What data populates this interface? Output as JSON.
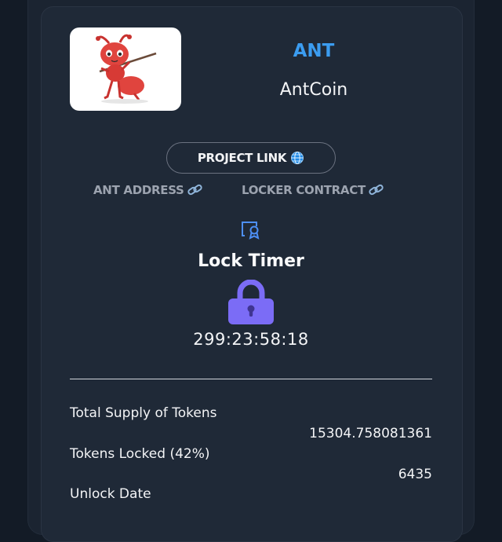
{
  "token": {
    "symbol": "ANT",
    "name": "AntCoin",
    "logo_icon": "ant-mascot-logo"
  },
  "links": {
    "project_label": "PROJECT LINK",
    "project_icon": "globe-icon",
    "address_label": "ANT ADDRESS",
    "contract_label": "LOCKER CONTRACT",
    "link_icon": "chain-link-icon"
  },
  "lock": {
    "badge_icon": "certificate-icon",
    "title": "Lock Timer",
    "lock_icon": "padlock-icon",
    "countdown": "299:23:58:18"
  },
  "stats": {
    "total_supply_label": "Total Supply of Tokens",
    "total_supply_value": "15304.758081361",
    "locked_label": "Tokens Locked (42%)",
    "locked_value": "6435",
    "unlock_label": "Unlock Date"
  },
  "colors": {
    "accent": "#3b9cf0",
    "lock_purple": "#7b6cf6",
    "background": "#131b26",
    "card": "#1f2937"
  }
}
